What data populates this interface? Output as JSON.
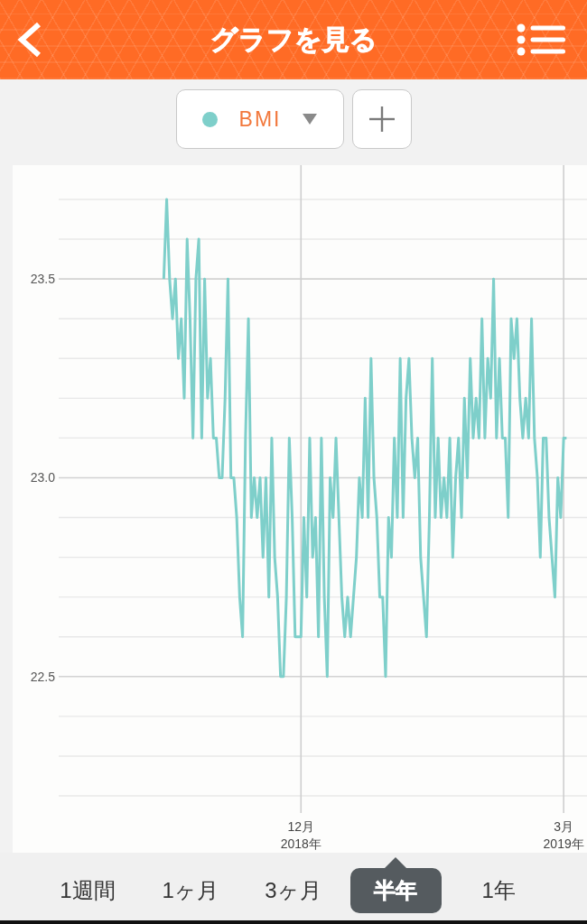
{
  "header": {
    "title": "グラフを見る"
  },
  "metric_selector": {
    "label": "BMI"
  },
  "chart": {
    "chart_data": {
      "type": "line",
      "ylim": [
        22.2,
        23.7
      ],
      "grid": true,
      "categories": [
        null,
        null,
        null,
        null,
        null,
        null,
        null,
        null,
        null,
        null,
        null,
        null,
        null,
        null,
        null,
        null,
        null,
        null,
        null,
        null,
        null,
        null,
        null,
        null,
        null,
        null,
        null,
        null,
        null,
        null,
        null,
        null,
        null,
        null,
        null,
        null,
        null,
        null,
        null,
        null,
        null,
        null,
        null,
        null,
        null,
        null,
        null,
        null,
        null,
        null,
        null,
        null,
        null,
        null,
        null,
        null,
        null,
        null,
        null,
        null,
        null,
        null,
        null,
        null,
        null,
        null,
        null,
        null,
        null,
        null,
        null,
        null,
        null,
        null,
        null,
        null,
        null,
        null,
        null,
        null,
        null,
        null,
        null,
        "12月\n2018年",
        null,
        null,
        null,
        null,
        null,
        null,
        null,
        null,
        null,
        null,
        null,
        null,
        null,
        null,
        null,
        null,
        null,
        null,
        null,
        null,
        null,
        null,
        null,
        null,
        null,
        null,
        null,
        null,
        null,
        null,
        null,
        null,
        null,
        null,
        null,
        null,
        null,
        null,
        null,
        null,
        null,
        null,
        null,
        null,
        null,
        null,
        null,
        null,
        null,
        null,
        null,
        null,
        null,
        null,
        null,
        null,
        null,
        null,
        null,
        null,
        null,
        null,
        null,
        null,
        null,
        null,
        null,
        null,
        null,
        null,
        null,
        null,
        null,
        null,
        null,
        null,
        null,
        null,
        null,
        null,
        null,
        null,
        null,
        null,
        null,
        null,
        null,
        null,
        null,
        "3月\n2019年",
        null,
        null,
        null,
        null,
        null,
        null,
        null,
        null
      ],
      "yticks": [
        {
          "value": 22.5,
          "label": "22.5"
        },
        {
          "value": 23,
          "label": "23.0"
        },
        {
          "value": 23.5,
          "label": "23.5"
        }
      ],
      "series": [
        {
          "color": "#7ecfca",
          "values": [
            null,
            null,
            null,
            null,
            null,
            null,
            null,
            null,
            null,
            null,
            null,
            null,
            null,
            null,
            null,
            null,
            null,
            null,
            null,
            null,
            null,
            null,
            null,
            null,
            null,
            null,
            null,
            null,
            null,
            null,
            null,
            null,
            null,
            null,
            null,
            null,
            23.5,
            23.7,
            23.5,
            23.4,
            23.5,
            23.3,
            23.4,
            23.2,
            23.6,
            23.4,
            23.1,
            23.5,
            23.6,
            23.1,
            23.5,
            23.2,
            23.3,
            23.1,
            23.1,
            23.0,
            23.0,
            23.2,
            23.5,
            23.0,
            23.0,
            22.9,
            22.7,
            22.6,
            23.1,
            23.4,
            22.9,
            23.0,
            22.9,
            23.0,
            22.8,
            23.0,
            22.7,
            23.1,
            22.8,
            22.7,
            22.5,
            22.5,
            22.7,
            23.1,
            22.9,
            22.6,
            22.6,
            22.6,
            22.9,
            22.7,
            23.1,
            22.8,
            22.9,
            22.6,
            23.1,
            22.7,
            22.5,
            23.0,
            22.9,
            23.1,
            22.9,
            22.7,
            22.6,
            22.7,
            22.6,
            22.7,
            22.8,
            23.0,
            22.9,
            23.2,
            22.9,
            23.3,
            23.0,
            22.9,
            22.7,
            22.7,
            22.5,
            22.9,
            22.8,
            23.1,
            22.9,
            23.3,
            22.9,
            23.2,
            23.3,
            23.1,
            23.0,
            23.1,
            22.8,
            22.7,
            22.6,
            22.9,
            23.3,
            22.9,
            23.1,
            22.9,
            23.0,
            22.9,
            23.1,
            22.8,
            23.0,
            23.1,
            22.9,
            23.2,
            23.0,
            23.3,
            23.1,
            23.2,
            23.1,
            23.4,
            23.1,
            23.3,
            23.2,
            23.5,
            23.1,
            23.3,
            23.1,
            23.1,
            22.9,
            23.4,
            23.3,
            23.4,
            23.2,
            23.1,
            23.2,
            23.1,
            23.4,
            23.1,
            23.0,
            22.8,
            23.1,
            23.1,
            22.9,
            22.8,
            22.7,
            23.0,
            22.9,
            23.1,
            23.1,
            null,
            null,
            null,
            null,
            null,
            null,
            null
          ]
        }
      ]
    }
  },
  "period_tabs": [
    {
      "label": "1週間",
      "selected": false
    },
    {
      "label": "1ヶ月",
      "selected": false
    },
    {
      "label": "3ヶ月",
      "selected": false
    },
    {
      "label": "半年",
      "selected": true
    },
    {
      "label": "1年",
      "selected": false
    }
  ]
}
